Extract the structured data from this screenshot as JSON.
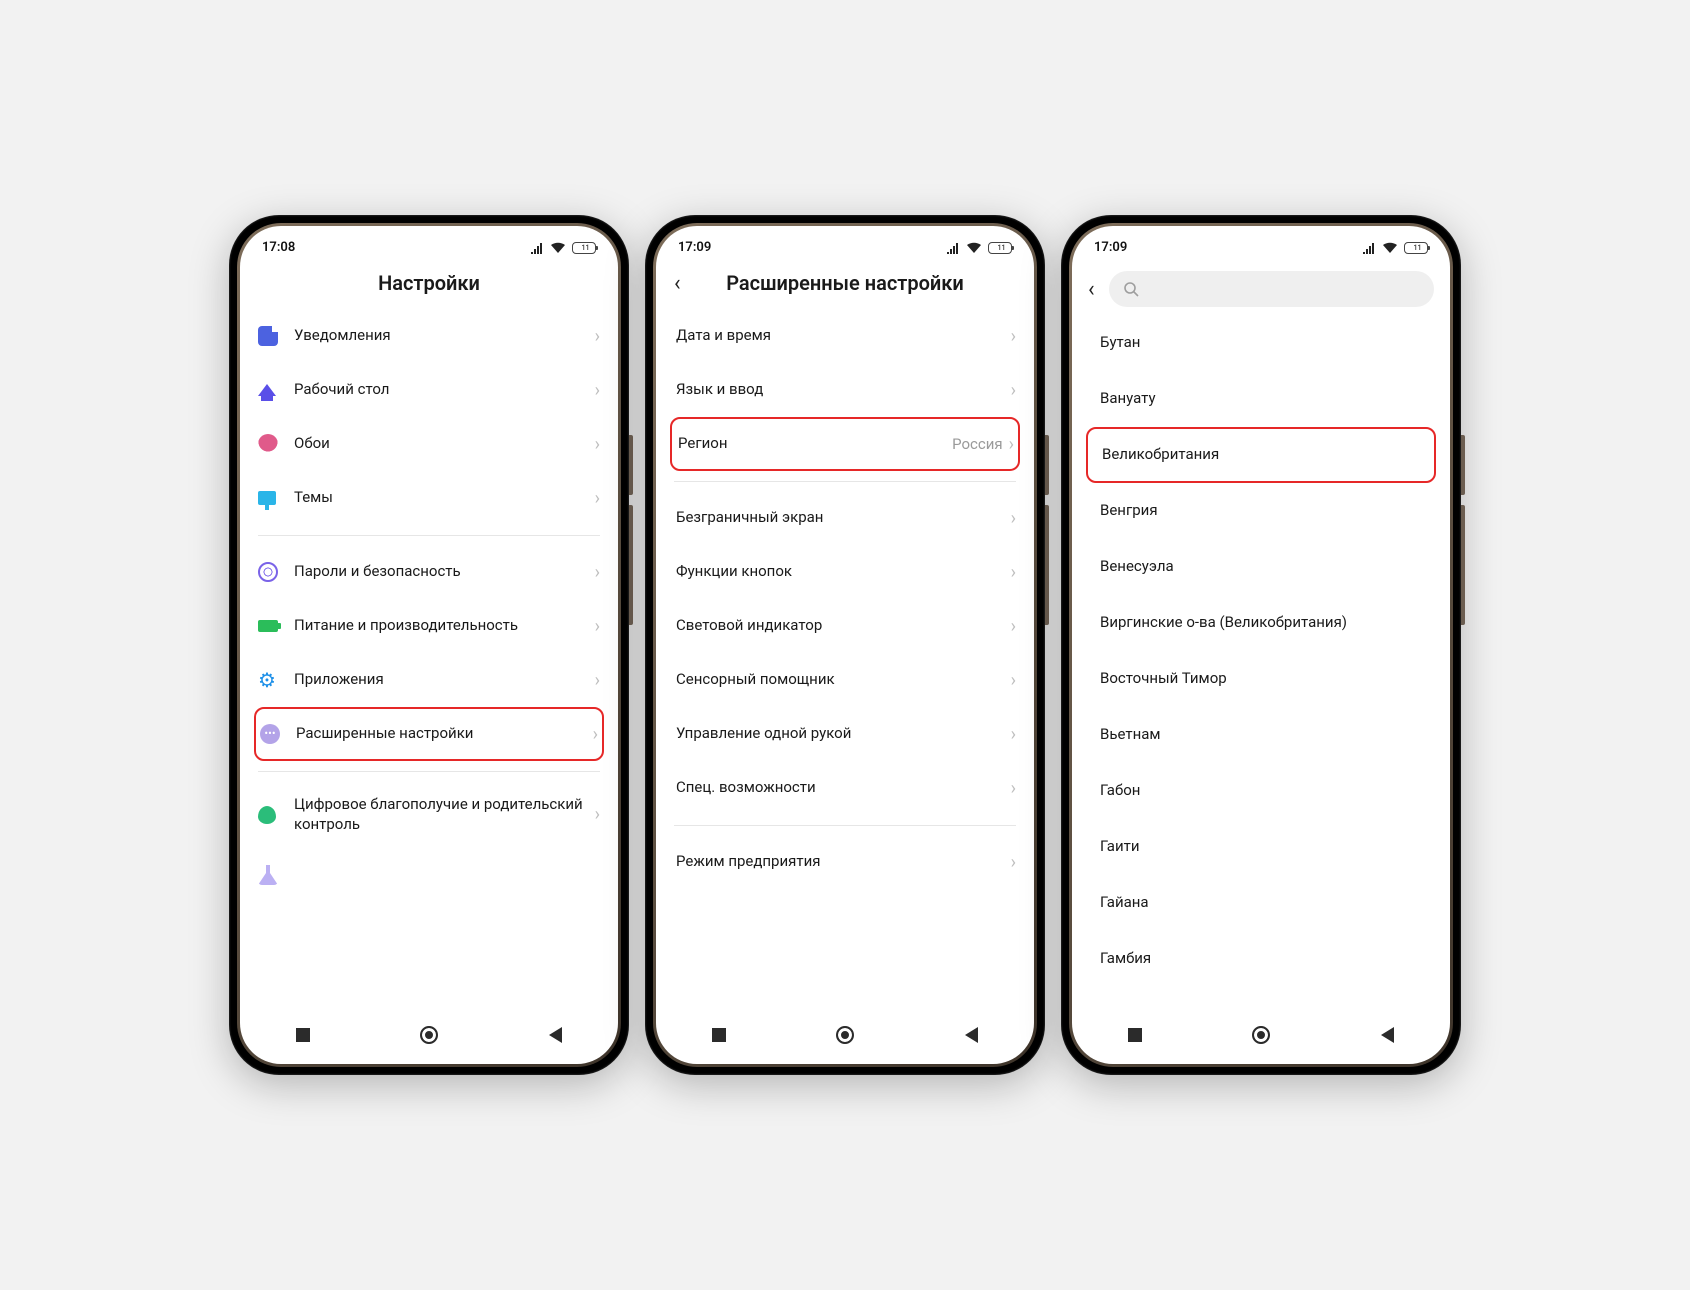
{
  "status": {
    "time1": "17:08",
    "time2": "17:09",
    "time3": "17:09",
    "battery": "11"
  },
  "phone1": {
    "title": "Настройки",
    "items": [
      {
        "label": "Уведомления"
      },
      {
        "label": "Рабочий стол"
      },
      {
        "label": "Обои"
      },
      {
        "label": "Темы"
      }
    ],
    "items2": [
      {
        "label": "Пароли и безопасность"
      },
      {
        "label": "Питание и производительность"
      },
      {
        "label": "Приложения"
      },
      {
        "label": "Расширенные настройки"
      }
    ],
    "items3": [
      {
        "label": "Цифровое благополучие и родительский контроль"
      }
    ]
  },
  "phone2": {
    "title": "Расширенные настройки",
    "items": [
      {
        "label": "Дата и время"
      },
      {
        "label": "Язык и ввод"
      },
      {
        "label": "Регион",
        "value": "Россия"
      }
    ],
    "items2": [
      {
        "label": "Безграничный экран"
      },
      {
        "label": "Функции кнопок"
      },
      {
        "label": "Световой индикатор"
      },
      {
        "label": "Сенсорный помощник"
      },
      {
        "label": "Управление одной рукой"
      },
      {
        "label": "Спец. возможности"
      }
    ],
    "items3": [
      {
        "label": "Режим предприятия"
      }
    ]
  },
  "phone3": {
    "countries": [
      "Бутан",
      "Вануату",
      "Великобритания",
      "Венгрия",
      "Венесуэла",
      "Виргинские о-ва (Великобритания)",
      "Восточный Тимор",
      "Вьетнам",
      "Габон",
      "Гаити",
      "Гайана",
      "Гамбия"
    ],
    "highlight_index": 2
  }
}
